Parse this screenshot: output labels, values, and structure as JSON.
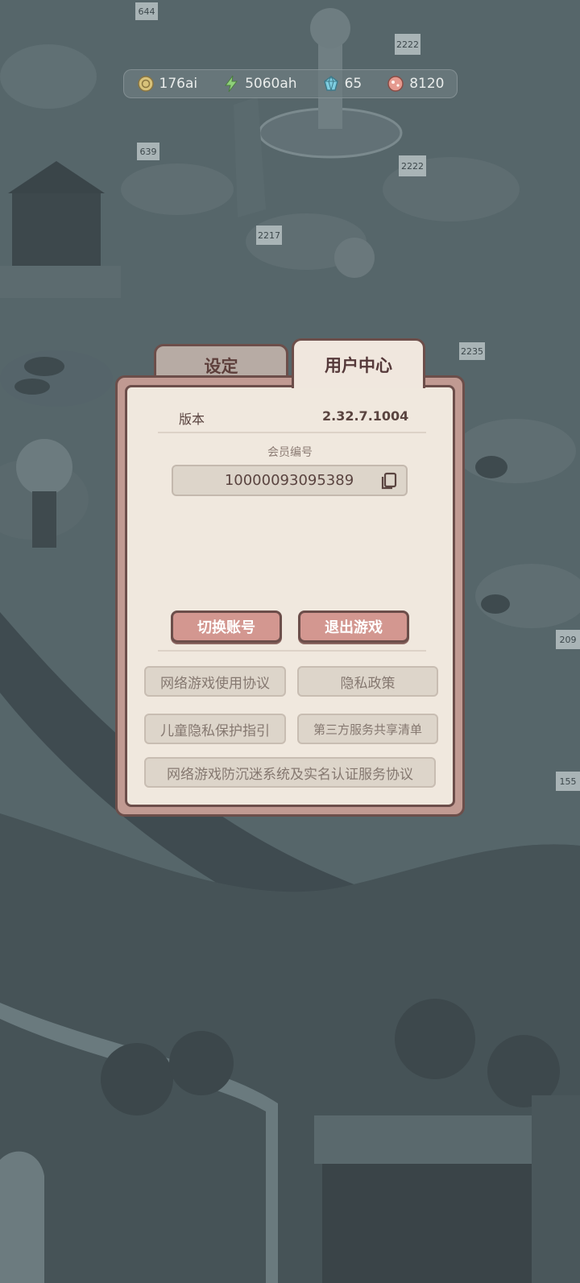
{
  "resources": [
    {
      "icon": "gold-coin-icon",
      "value": "176ai"
    },
    {
      "icon": "energy-bolt-icon",
      "value": "5060ah"
    },
    {
      "icon": "blue-gem-icon",
      "value": "65"
    },
    {
      "icon": "red-orb-icon",
      "value": "8120"
    }
  ],
  "scene_signs": [
    "644",
    "2222",
    "639",
    "2222",
    "2217",
    "2235",
    "209",
    "155"
  ],
  "tabs": {
    "settings": "设定",
    "user_center": "用户中心"
  },
  "user_center": {
    "version_label": "版本",
    "version_value": "2.32.7.1004",
    "member_id_label": "会员编号",
    "member_id_value": "10000093095389",
    "switch_account": "切换账号",
    "exit_game": "退出游戏",
    "links": {
      "game_agreement": "网络游戏使用协议",
      "privacy_policy": "隐私政策",
      "child_privacy": "儿童隐私保护指引",
      "third_party_sharing": "第三方服务共享清单",
      "anti_addiction": "网络游戏防沉迷系统及实名认证服务协议"
    }
  },
  "colors": {
    "overlay": "#48555a",
    "panel_border": "#6c4e4a",
    "panel_fill": "#f0e8de",
    "accent_button": "#d39790",
    "gray_button": "#ddd5ca"
  }
}
